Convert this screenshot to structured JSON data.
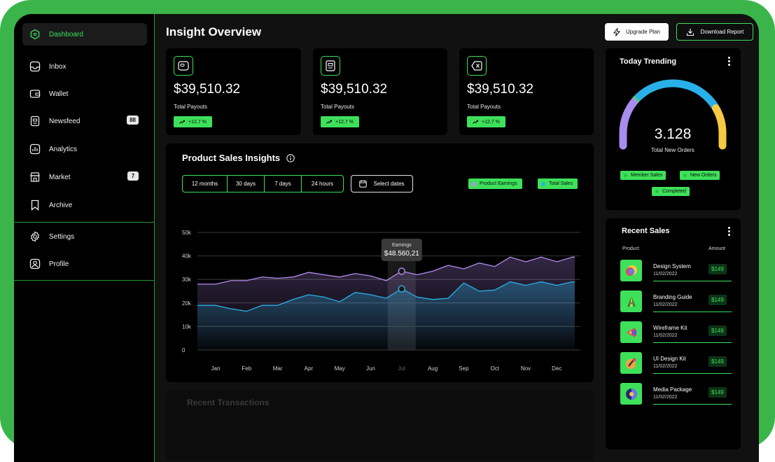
{
  "sidebar": {
    "items": [
      {
        "label": "Dashboard",
        "icon": "dashboard-icon"
      },
      {
        "label": "Inbox",
        "icon": "inbox-icon"
      },
      {
        "label": "Wallet",
        "icon": "wallet-icon"
      },
      {
        "label": "Newsfeed",
        "icon": "newsfeed-icon",
        "badge": "88"
      },
      {
        "label": "Analytics",
        "icon": "analytics-icon"
      },
      {
        "label": "Market",
        "icon": "market-icon",
        "badge": "7"
      },
      {
        "label": "Archive",
        "icon": "bookmark-icon"
      },
      {
        "label": "Settings",
        "icon": "gear-icon"
      },
      {
        "label": "Profile",
        "icon": "user-icon"
      }
    ]
  },
  "header": {
    "title": "Insight Overview",
    "upgrade_label": "Upgrade Plan",
    "download_label": "Download Report"
  },
  "stats": [
    {
      "amount": "$39,510.32",
      "label": "Total Payouts",
      "delta": "+12,7 %",
      "icon": "card-icon"
    },
    {
      "amount": "$39,510.32",
      "label": "Total Payouts",
      "delta": "+12,7 %",
      "icon": "receipt-icon"
    },
    {
      "amount": "$39,510.32",
      "label": "Total Payouts",
      "delta": "+12,7 %",
      "icon": "cancel-icon"
    }
  ],
  "insights": {
    "title": "Product Sales Insights",
    "ranges": [
      "12 months",
      "30 days",
      "7 days",
      "24 hours"
    ],
    "select_dates": "Select dates",
    "legend": [
      {
        "label": "Product Earnings",
        "color": "#b58cf0"
      },
      {
        "label": "Total Sales",
        "color": "#2ab0e8"
      }
    ],
    "tooltip": {
      "label": "Earnings",
      "value": "$48.560,21"
    }
  },
  "chart_data": {
    "type": "area",
    "categories": [
      "Jan",
      "Feb",
      "Mar",
      "Apr",
      "May",
      "Jun",
      "Jul",
      "Aug",
      "Sep",
      "Oct",
      "Nov",
      "Dec"
    ],
    "y_ticks": [
      "50k",
      "40k",
      "30k",
      "20k",
      "10k",
      "0"
    ],
    "ylim": [
      0,
      50000
    ],
    "highlight_category": "Jul",
    "series": [
      {
        "name": "Product Earnings",
        "color": "#b58cf0",
        "x": [
          0,
          0.5,
          1,
          1.5,
          2,
          2.5,
          3,
          3.5,
          4,
          4.5,
          5,
          5.5,
          6,
          6.5,
          7,
          7.5,
          8,
          8.5,
          9,
          9.5,
          10,
          10.5,
          11,
          11.5
        ],
        "values": [
          28000,
          29500,
          29500,
          31000,
          30500,
          31000,
          33000,
          32000,
          31000,
          32500,
          31500,
          29500,
          33500,
          32000,
          33500,
          36000,
          34500,
          37000,
          35500,
          39500,
          37500,
          39500,
          37500,
          39500
        ]
      },
      {
        "name": "Total Sales",
        "color": "#2ab0e8",
        "x": [
          0,
          0.5,
          1,
          1.5,
          2,
          2.5,
          3,
          3.5,
          4,
          4.5,
          5,
          5.5,
          6,
          6.5,
          7,
          7.5,
          8,
          8.5,
          9,
          9.5,
          10,
          10.5,
          11,
          11.5
        ],
        "values": [
          19000,
          17500,
          16500,
          19000,
          19000,
          21500,
          23500,
          22500,
          20500,
          24500,
          23500,
          22000,
          26000,
          22500,
          21500,
          22000,
          28500,
          25000,
          25500,
          29000,
          27500,
          29000,
          27500,
          29000
        ]
      }
    ]
  },
  "trending": {
    "title": "Today Trending",
    "value": "3.128",
    "caption": "Total New Orders",
    "chips": [
      "Member Sales",
      "New Orders",
      "Completed"
    ],
    "gauge_colors": [
      "#a98cf0",
      "#3ee05a",
      "#2ab0e8",
      "#f6c945"
    ]
  },
  "recent_sales": {
    "title": "Recent Sales",
    "col_product": "Product",
    "col_amount": "Amount",
    "rows": [
      {
        "name": "Design System",
        "date": "11/02/2022",
        "price": "$149",
        "icon": "design-system-icon"
      },
      {
        "name": "Branding Guide",
        "date": "11/02/2022",
        "price": "$149",
        "icon": "branding-icon"
      },
      {
        "name": "Wireframe Kit",
        "date": "11/02/2022",
        "price": "$149",
        "icon": "wireframe-icon"
      },
      {
        "name": "UI Design Kit",
        "date": "11/02/2022",
        "price": "$149",
        "icon": "ui-kit-icon"
      },
      {
        "name": "Media Package",
        "date": "11/02/2022",
        "price": "$149",
        "icon": "media-icon"
      }
    ]
  },
  "transactions": {
    "title": "Recent Transactions"
  }
}
